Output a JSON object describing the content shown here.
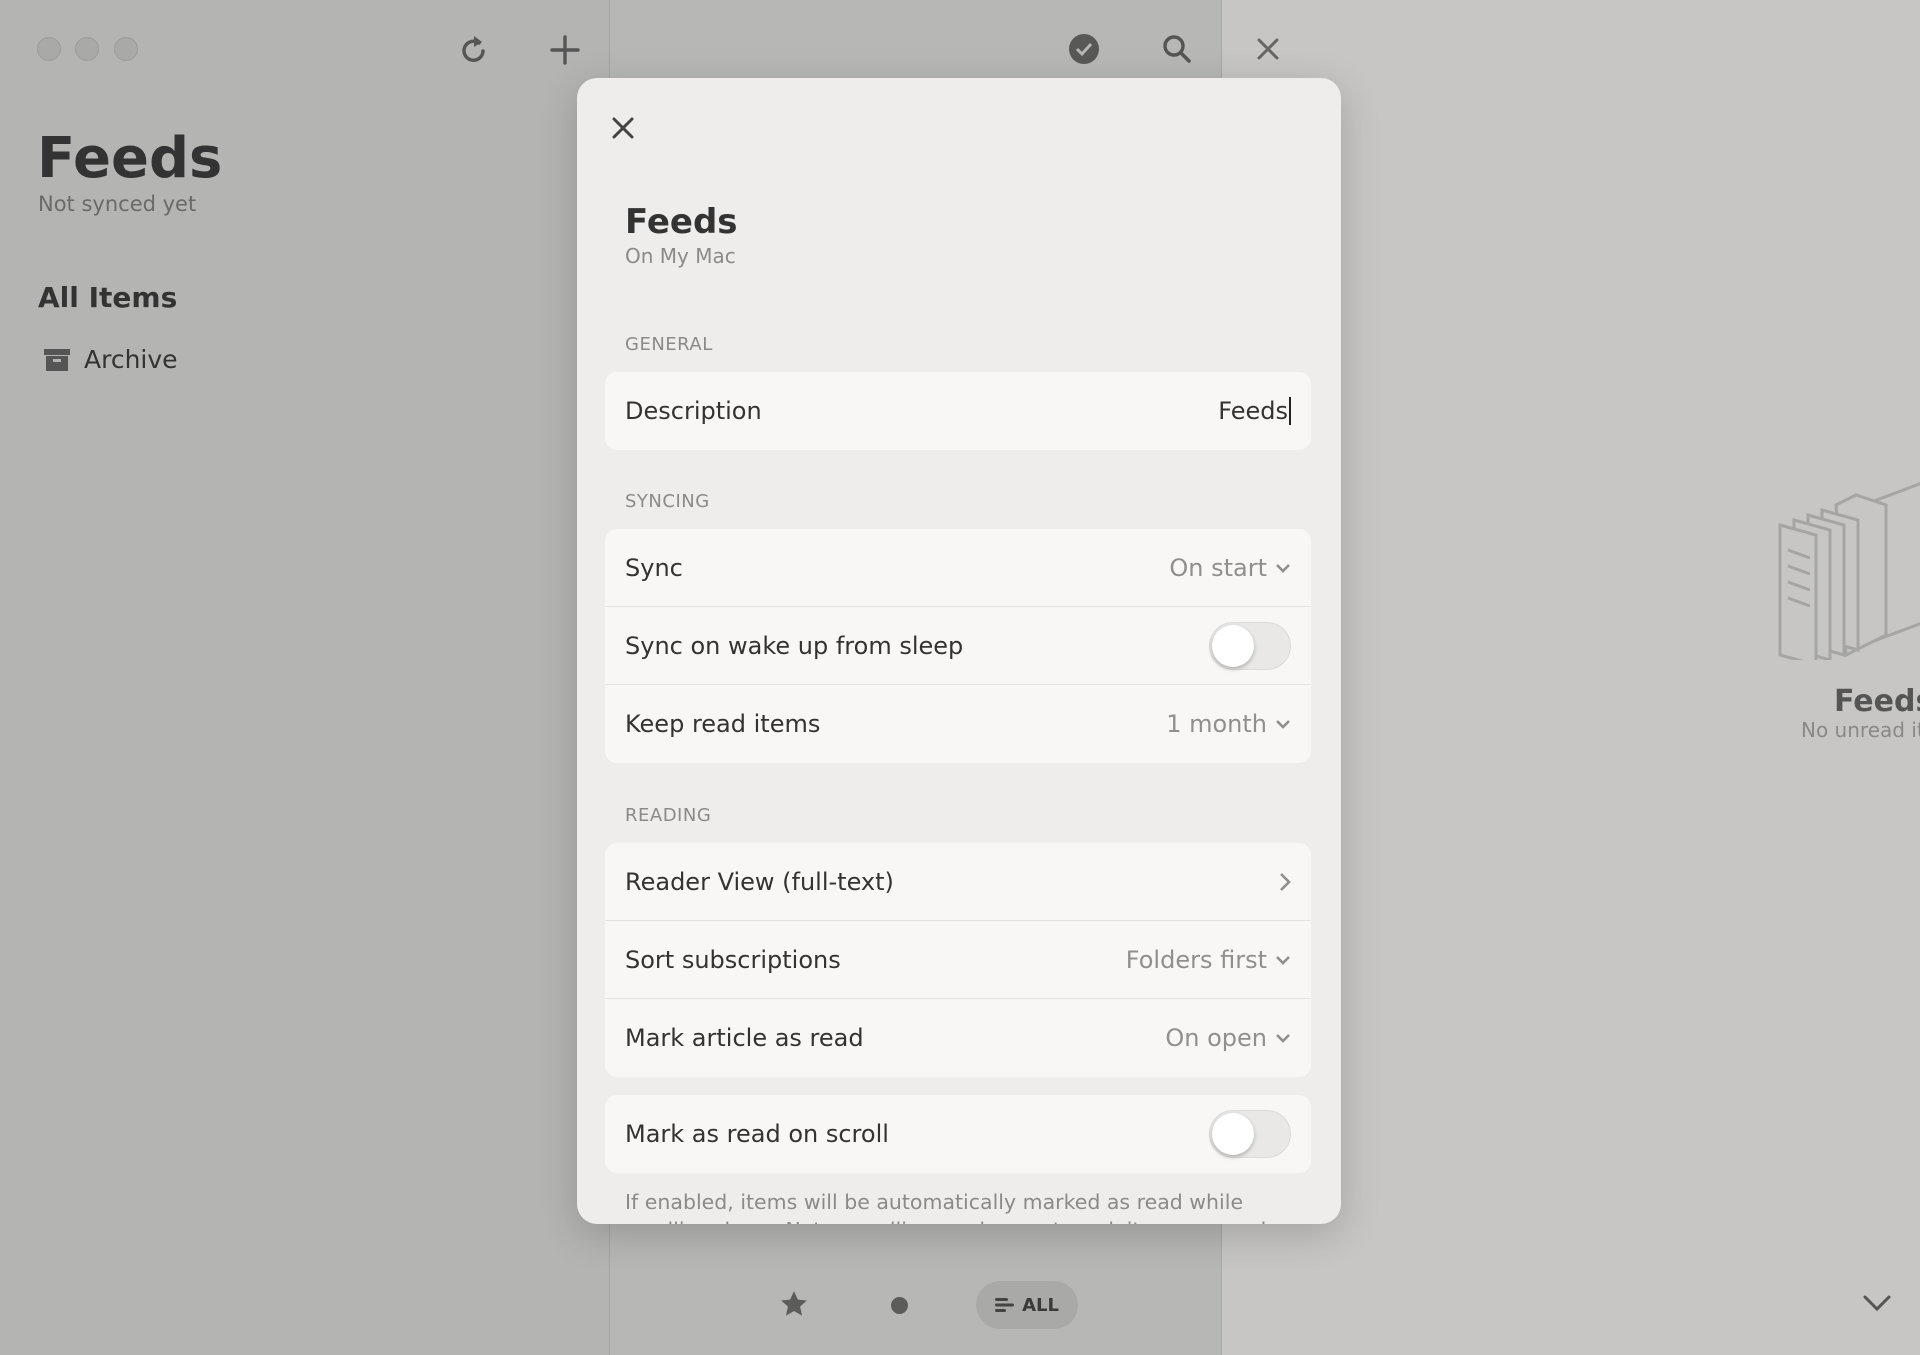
{
  "sidebar": {
    "title": "Feeds",
    "subtitle": "Not synced yet",
    "all_items": "All Items",
    "archive": "Archive"
  },
  "empty_state": {
    "title": "Feeds",
    "subtitle": "No unread ite"
  },
  "bottom_bar": {
    "all_label": "ALL"
  },
  "dialog": {
    "title": "Feeds",
    "subtitle": "On My Mac",
    "general": {
      "header": "GENERAL",
      "description_label": "Description",
      "description_value": "Feeds"
    },
    "syncing": {
      "header": "SYNCING",
      "sync_label": "Sync",
      "sync_value": "On start",
      "wake_label": "Sync on wake up from sleep",
      "wake_on": false,
      "keep_label": "Keep read items",
      "keep_value": "1 month"
    },
    "reading": {
      "header": "READING",
      "reader_label": "Reader View (full-text)",
      "sort_label": "Sort subscriptions",
      "sort_value": "Folders first",
      "mark_label": "Mark article as read",
      "mark_value": "On open"
    },
    "scroll": {
      "label": "Mark as read on scroll",
      "on": false,
      "help": "If enabled, items will be automatically marked as read while scrolling down. Note: scrolling up does not mark items as read."
    }
  }
}
